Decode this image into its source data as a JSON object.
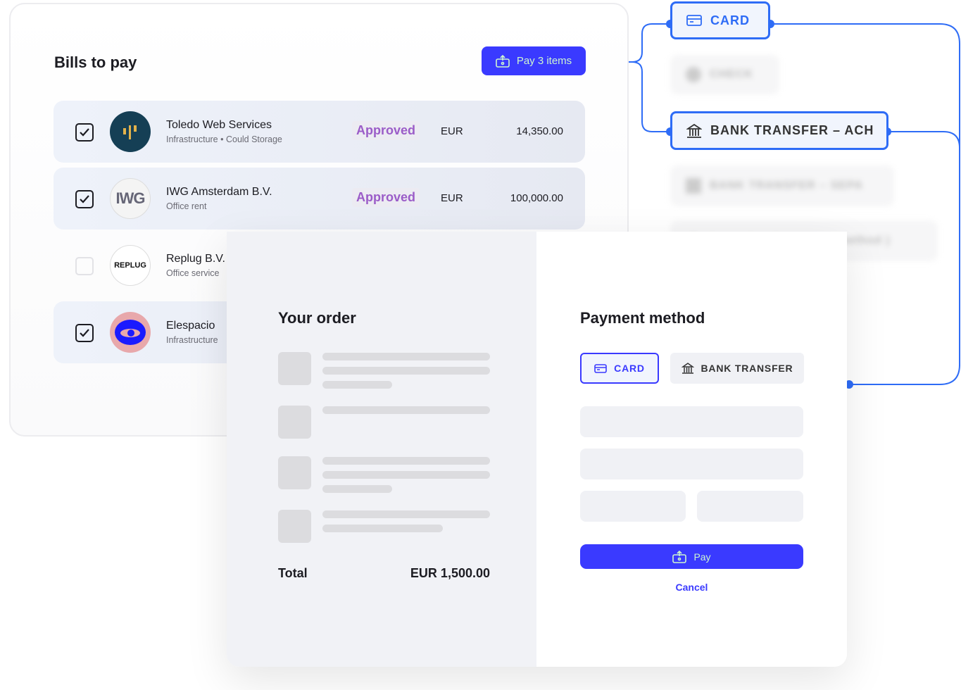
{
  "bills": {
    "title": "Bills to pay",
    "pay_button": "Pay 3 items",
    "rows": [
      {
        "name": "Toledo Web Services",
        "category": "Infrastructure • Could Storage",
        "status": "Approved",
        "currency": "EUR",
        "amount": "14,350.00",
        "checked": true,
        "logo_text": ""
      },
      {
        "name": "IWG Amsterdam B.V.",
        "category": "Office rent",
        "status": "Approved",
        "currency": "EUR",
        "amount": "100,000.00",
        "checked": true,
        "logo_text": "IWG"
      },
      {
        "name": "Replug B.V.",
        "category": "Office service",
        "checked": false,
        "logo_text": "REPLUG"
      },
      {
        "name": "Elespacio",
        "category": "Infrastructure",
        "checked": true,
        "logo_text": ""
      }
    ]
  },
  "order": {
    "title": "Your order",
    "total_label": "Total",
    "total_value": "EUR 1,500.00"
  },
  "payment": {
    "title": "Payment method",
    "card": "CARD",
    "bank": "BANK TRANSFER",
    "pay": "Pay",
    "cancel": "Cancel"
  },
  "methods": {
    "card": "CARD",
    "check": "CHECK",
    "ach": "BANK TRANSFER – ACH",
    "sepa": "BANK TRANSFER – SEPA",
    "local": "( your local payment method )"
  },
  "colors": {
    "accent": "#3a3aff",
    "connector": "#2e6cf6",
    "status": "#9b5cc8",
    "pay_text": "#cdf6cf"
  }
}
